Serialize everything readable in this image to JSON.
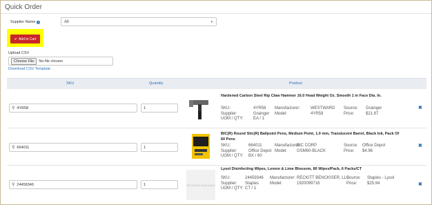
{
  "page": {
    "title": "Quick Order"
  },
  "supplier": {
    "label": "Supplier Name",
    "selected": "All"
  },
  "add_to_cart": {
    "label": "Add to Cart"
  },
  "upload": {
    "label": "Upload CSV",
    "choose_label": "Choose File",
    "file_status": "No file chosen",
    "download_link": "Download CSV Template"
  },
  "table": {
    "headers": {
      "sku": "SKU",
      "quantity": "Quantity",
      "product": "Product"
    },
    "rows": [
      {
        "sku": "4YR58",
        "quantity": "1",
        "name": "Hardened Carbon Steel Rip Claw Hammer 16.0 Head Weight Oz. Smooth 1 in Face Dia. In.",
        "sku_label": "SKU:",
        "sku_value": "4YR58",
        "supplier_label": "Supplier:",
        "supplier_value": "Grainger",
        "uom_label": "UOM / QTY:",
        "uom_value": "EA / 1",
        "manufacturer_label": "Manufacturer:",
        "manufacturer_value": "WESTWARD",
        "model_label": "Model:",
        "model_value": "4YR58",
        "source_label": "Source:",
        "source_value": "Grainger",
        "price_label": "Price:",
        "price_value": "$21.87"
      },
      {
        "sku": "664011",
        "quantity": "1",
        "name": "BIC(R) Round Stic(R) Ballpoint Pens, Medium Point, 1.0 mm, Translucent Barrel, Black Ink, Pack Of 60 Pens",
        "sku_label": "SKU:",
        "sku_value": "664011",
        "supplier_label": "Supplier:",
        "supplier_value": "Office Depot",
        "uom_label": "UOM / QTY:",
        "uom_value": "BX / 60",
        "manufacturer_label": "Manufacturer:",
        "manufacturer_value": "BIC CORP",
        "model_label": "Model:",
        "model_value": "GSM60-BLACK",
        "source_label": "Source:",
        "source_value": "Office Depot",
        "price_label": "Price:",
        "price_value": "$4.96"
      },
      {
        "sku": "24459346",
        "quantity": "1",
        "name": "Lysol Disinfecting Wipes, Lemon & Lime Blossom, 80 Wipes/Pack, 6 Packs/CT",
        "sku_label": "SKU:",
        "sku_value": "24459346",
        "supplier_label": "Supplier:",
        "supplier_value": "Staples",
        "uom_label": "UOM / QTY:",
        "uom_value": "CT / 1",
        "manufacturer_label": "Manufacturer:",
        "manufacturer_value": "RECKITT BENCKISER, LLC",
        "model_label": "Model:",
        "model_value": "1920099716",
        "source_label": "Source:",
        "source_value": "Staples - Lysol",
        "price_label": "Price:",
        "price_value": "$25.94",
        "no_image_text": "NO IMAGE AVAILABLE"
      }
    ]
  },
  "colors": {
    "highlight": "#ffff00",
    "button": "#c9262a",
    "link": "#2a6fb8"
  },
  "icons": {
    "info": "info-icon",
    "check": "check-icon",
    "search": "search-icon",
    "remove": "close-icon",
    "dropdown": "chevron-down-icon"
  }
}
